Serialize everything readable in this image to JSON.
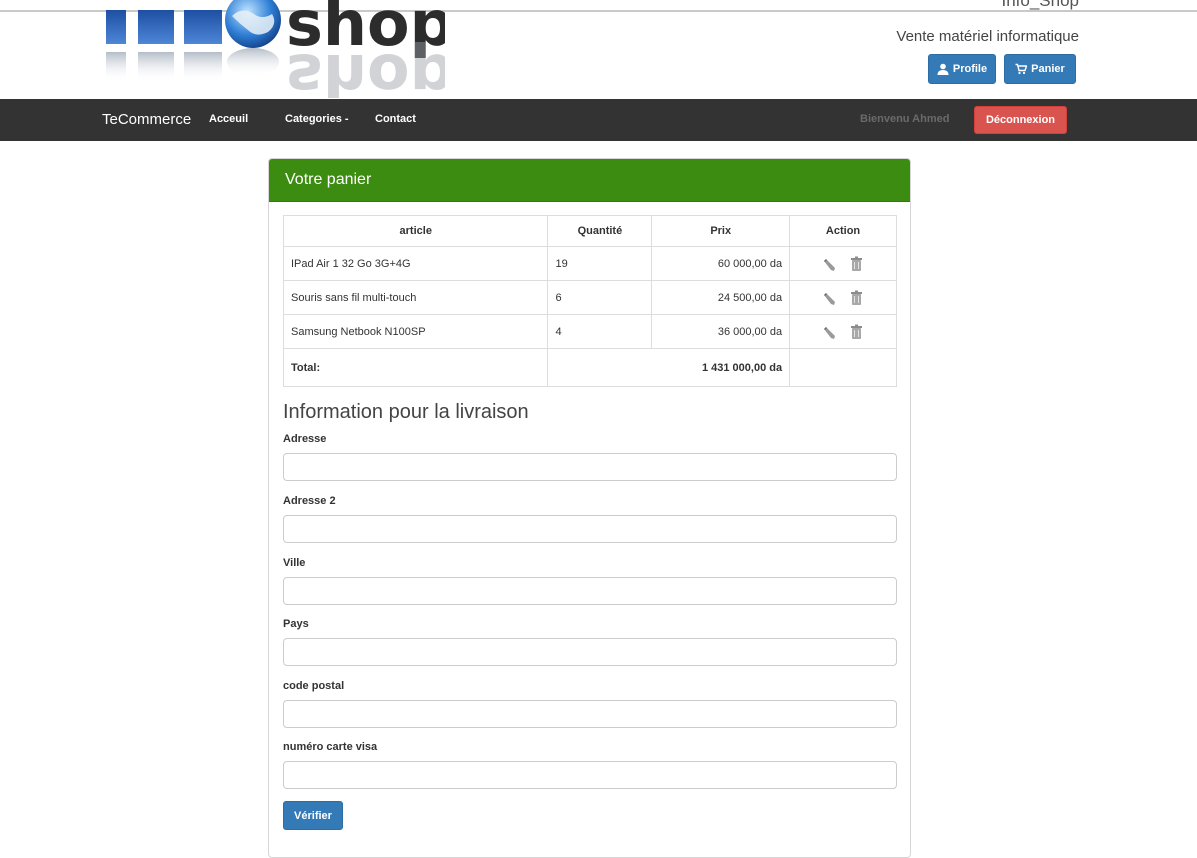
{
  "header": {
    "site_name": "Info_Shop",
    "tagline": "Vente matériel informatique",
    "profile_label": "Profile",
    "cart_label": "Panier"
  },
  "navbar": {
    "brand": "TeCommerce",
    "links": [
      "Acceuil",
      "Categories -",
      "Contact"
    ],
    "welcome": "Bienvenu Ahmed",
    "logout_label": "Déconnexion"
  },
  "cart": {
    "title": "Votre panier",
    "columns": [
      "article",
      "Quantité",
      "Prix",
      "Action"
    ],
    "items": [
      {
        "article": "IPad Air 1 32 Go 3G+4G",
        "quantite": "19",
        "prix": "60 000,00 da"
      },
      {
        "article": "Souris sans fil multi-touch",
        "quantite": "6",
        "prix": "24 500,00 da"
      },
      {
        "article": "Samsung Netbook N100SP",
        "quantite": "4",
        "prix": "36 000,00 da"
      }
    ],
    "total_label": "Total:",
    "total_value": "1 431 000,00 da"
  },
  "delivery": {
    "title": "Information pour la livraison",
    "fields": [
      {
        "label": "Adresse",
        "value": ""
      },
      {
        "label": "Adresse 2",
        "value": ""
      },
      {
        "label": "Ville",
        "value": ""
      },
      {
        "label": "Pays",
        "value": ""
      },
      {
        "label": "code postal",
        "value": ""
      },
      {
        "label": "numéro carte visa",
        "value": ""
      }
    ],
    "submit_label": "Vérifier"
  },
  "colors": {
    "navbar_bg": "#333333",
    "panel_header": "#3c8c12",
    "primary_button": "#337ab7",
    "danger_button": "#d9534f"
  },
  "icons": [
    "user-icon",
    "shopping-cart-icon",
    "edit-pencil-icon",
    "trash-icon"
  ]
}
